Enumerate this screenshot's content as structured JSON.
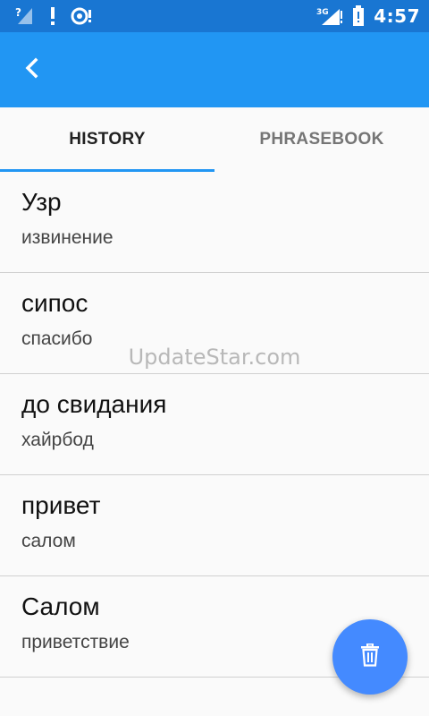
{
  "status_bar": {
    "time": "4:57",
    "left_icons": [
      "signal-unknown-icon",
      "alert-icon",
      "notification-icon"
    ],
    "network_label": "3G",
    "right_icons": [
      "signal-3g-icon",
      "battery-alert-icon"
    ]
  },
  "app_bar": {
    "back_icon": "chevron-left-icon",
    "color": "#2196f3"
  },
  "tabs": [
    {
      "label": "HISTORY",
      "active": true
    },
    {
      "label": "PHRASEBOOK",
      "active": false
    }
  ],
  "history": [
    {
      "title": "Узр",
      "subtitle": "извинение"
    },
    {
      "title": "сипос",
      "subtitle": "спасибо"
    },
    {
      "title": "до свидания",
      "subtitle": "хайрбод"
    },
    {
      "title": "привет",
      "subtitle": "салом"
    },
    {
      "title": "Салом",
      "subtitle": "приветствие"
    }
  ],
  "watermark": "UpdateStar.com",
  "fab": {
    "icon": "trash-icon",
    "color": "#448aff"
  },
  "colors": {
    "status_bar": "#1976d2",
    "accent": "#2196f3",
    "divider": "#d0d0d0"
  }
}
